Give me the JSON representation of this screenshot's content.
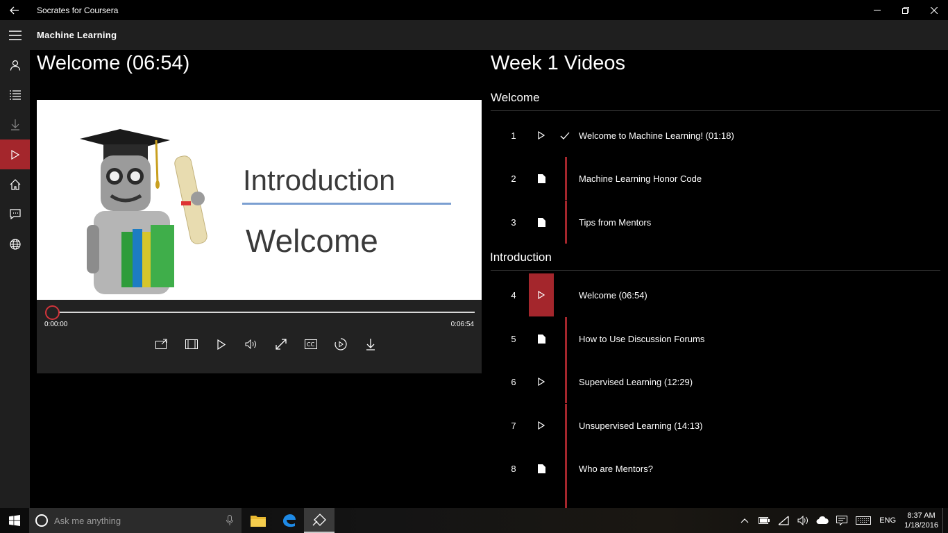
{
  "window": {
    "title": "Socrates for Coursera"
  },
  "header": {
    "course_title": "Machine Learning"
  },
  "rail": {
    "items": [
      {
        "icon": "profile-icon"
      },
      {
        "icon": "list-icon"
      },
      {
        "icon": "download-icon"
      },
      {
        "icon": "play-icon",
        "active": true
      },
      {
        "icon": "home-icon"
      },
      {
        "icon": "chat-icon"
      },
      {
        "icon": "globe-icon"
      }
    ]
  },
  "player": {
    "title": "Welcome (06:54)",
    "slide": {
      "heading": "Introduction",
      "subheading": "Welcome"
    },
    "current_time": "0:00:00",
    "duration": "0:06:54",
    "progress_fraction": 0.0
  },
  "list": {
    "title": "Week 1 Videos",
    "sections": [
      {
        "name": "Welcome",
        "items": [
          {
            "num": "1",
            "type": "video",
            "label": "Welcome to Machine Learning! (01:18)",
            "completed": true
          },
          {
            "num": "2",
            "type": "document",
            "label": "Machine Learning Honor Code"
          },
          {
            "num": "3",
            "type": "document",
            "label": "Tips from Mentors"
          }
        ]
      },
      {
        "name": "Introduction",
        "items": [
          {
            "num": "4",
            "type": "video",
            "label": "Welcome (06:54)",
            "active": true
          },
          {
            "num": "5",
            "type": "document",
            "label": "How to Use Discussion Forums"
          },
          {
            "num": "6",
            "type": "video",
            "label": "Supervised Learning (12:29)"
          },
          {
            "num": "7",
            "type": "video",
            "label": "Unsupervised Learning (14:13)"
          },
          {
            "num": "8",
            "type": "document",
            "label": "Who are Mentors?"
          }
        ]
      }
    ]
  },
  "taskbar": {
    "search_placeholder": "Ask me anything",
    "language": "ENG",
    "time": "8:37 AM",
    "date": "1/18/2016"
  },
  "colors": {
    "accent": "#a4262c",
    "panel": "#1f1f1f"
  }
}
